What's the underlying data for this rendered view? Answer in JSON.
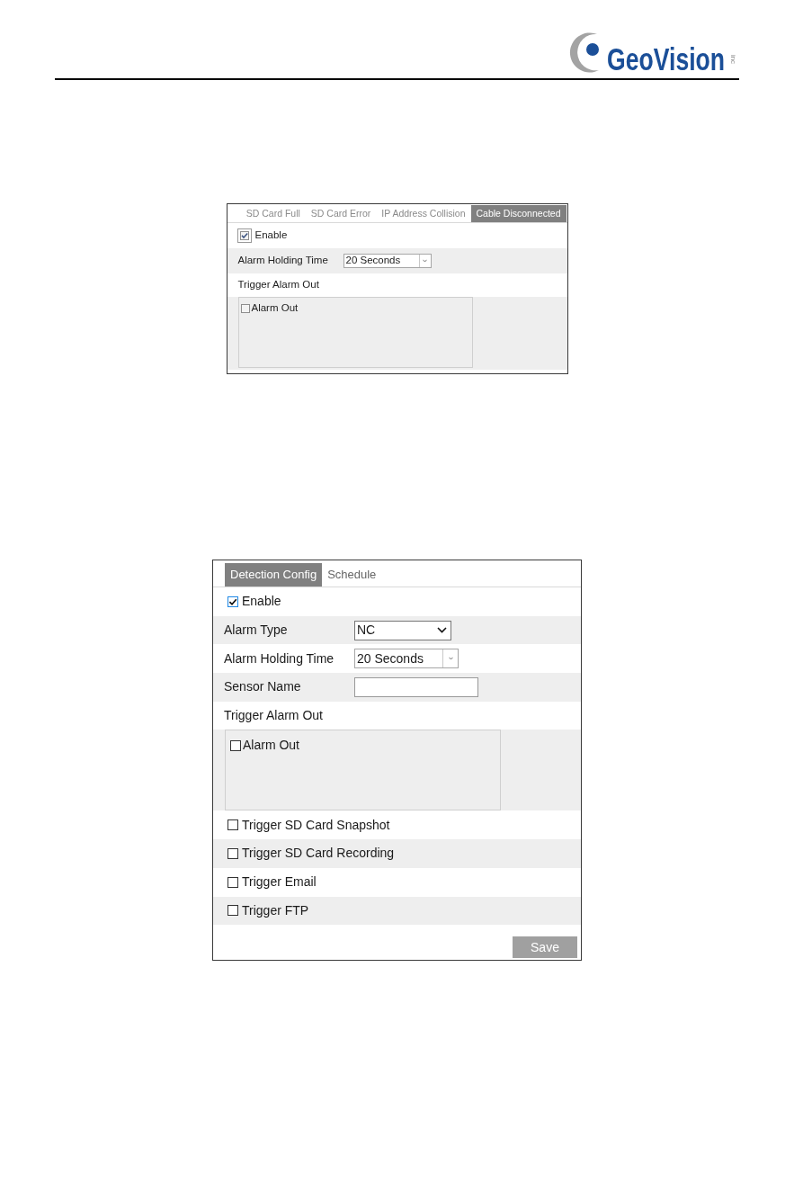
{
  "header": {
    "logo": {
      "wordmark": "GeoVision",
      "suffix": "inc"
    }
  },
  "panels": [
    {
      "tabs": [
        {
          "label": "SD Card Full",
          "selected": false
        },
        {
          "label": "SD Card Error",
          "selected": false
        },
        {
          "label": "IP Address Collision",
          "selected": false
        },
        {
          "label": "Cable Disconnected",
          "selected": true
        }
      ],
      "rows": [
        {
          "kind": "checkbox",
          "label": "Enable",
          "checked": true,
          "focused": true
        },
        {
          "kind": "combobox",
          "label": "Alarm Holding Time",
          "value": "20 Seconds"
        },
        {
          "kind": "heading",
          "label": "Trigger Alarm Out"
        },
        {
          "kind": "checklist",
          "items": [
            {
              "label": "Alarm Out",
              "checked": false,
              "focused": false
            }
          ]
        }
      ]
    },
    {
      "tabs": [
        {
          "label": "Detection Config",
          "selected": true
        },
        {
          "label": "Schedule",
          "selected": false
        }
      ],
      "rows": [
        {
          "kind": "checkbox",
          "label": "Enable",
          "checked": true,
          "focused": true
        },
        {
          "kind": "dropdown",
          "label": "Alarm Type",
          "value": "NC"
        },
        {
          "kind": "combobox",
          "label": "Alarm Holding Time",
          "value": "20 Seconds"
        },
        {
          "kind": "textfield",
          "label": "Sensor Name"
        },
        {
          "kind": "heading",
          "label": "Trigger Alarm Out"
        },
        {
          "kind": "checklist",
          "items": [
            {
              "label": "Alarm Out",
              "checked": false,
              "focused": false
            }
          ]
        },
        {
          "kind": "checkbox",
          "label": "Trigger SD Card Snapshot",
          "checked": false,
          "focused": false
        },
        {
          "kind": "checkbox",
          "label": "Trigger SD Card Recording",
          "checked": false,
          "focused": false
        },
        {
          "kind": "checkbox",
          "label": "Trigger Email",
          "checked": false,
          "focused": false
        },
        {
          "kind": "checkbox",
          "label": "Trigger FTP",
          "checked": false,
          "focused": false
        }
      ],
      "buttons": [
        {
          "label": "Save"
        }
      ]
    }
  ]
}
